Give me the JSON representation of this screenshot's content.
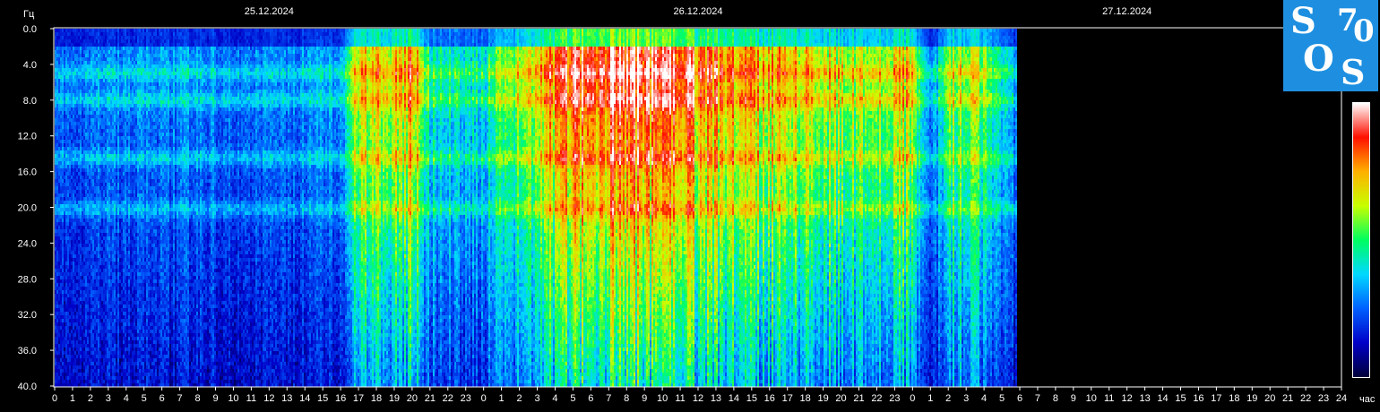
{
  "chart_data": {
    "type": "heatmap",
    "title": "",
    "ylabel": "Гц",
    "xlabel": "час",
    "dates": [
      "25.12.2024",
      "26.12.2024",
      "27.12.2024"
    ],
    "ylim": [
      0,
      40
    ],
    "y_ticks": [
      "0.0",
      "4.0",
      "8.0",
      "12.0",
      "16.0",
      "20.0",
      "24.0",
      "28.0",
      "32.0",
      "36.0",
      "40.0"
    ],
    "x_ticks": [
      "0",
      "1",
      "2",
      "3",
      "4",
      "5",
      "6",
      "7",
      "8",
      "9",
      "10",
      "11",
      "12",
      "13",
      "14",
      "15",
      "16",
      "17",
      "18",
      "19",
      "20",
      "21",
      "22",
      "23",
      "0",
      "1",
      "2",
      "3",
      "4",
      "5",
      "6",
      "7",
      "8",
      "9",
      "10",
      "11",
      "12",
      "13",
      "14",
      "15",
      "16",
      "17",
      "18",
      "19",
      "20",
      "21",
      "22",
      "23",
      "0",
      "1",
      "2",
      "3",
      "4",
      "5",
      "6",
      "7",
      "8",
      "9",
      "10",
      "11",
      "12",
      "13",
      "14",
      "15",
      "16",
      "17",
      "18",
      "19",
      "20",
      "21",
      "22",
      "23",
      "24"
    ],
    "x_range_hours": [
      0,
      72
    ],
    "data_end_hour": 53.8,
    "grid": false,
    "colorscale": [
      "#00003a",
      "#0000c8",
      "#0060ff",
      "#00d8ff",
      "#00ff60",
      "#c8ff00",
      "#ffb000",
      "#ff1000",
      "#ffffff"
    ],
    "intensity_profile": {
      "hours": [
        0,
        4,
        8,
        12,
        16,
        16.5,
        19,
        20,
        21,
        24,
        25.5,
        27,
        29,
        31,
        33,
        35,
        37,
        40,
        42,
        45,
        47.8,
        49,
        50,
        52,
        53.8
      ],
      "intensity": [
        0.25,
        0.3,
        0.3,
        0.28,
        0.32,
        0.62,
        0.72,
        0.78,
        0.45,
        0.42,
        0.58,
        0.7,
        0.86,
        0.92,
        0.9,
        0.86,
        0.78,
        0.72,
        0.68,
        0.62,
        0.7,
        0.25,
        0.62,
        0.6,
        0.3
      ]
    },
    "persistent_bands_hz": [
      4.8,
      7.8,
      14.3,
      20.0
    ]
  },
  "logo": {
    "letters": [
      "S",
      "7",
      "0",
      "O",
      "S"
    ],
    "bg_color": "#1e8fe0"
  }
}
